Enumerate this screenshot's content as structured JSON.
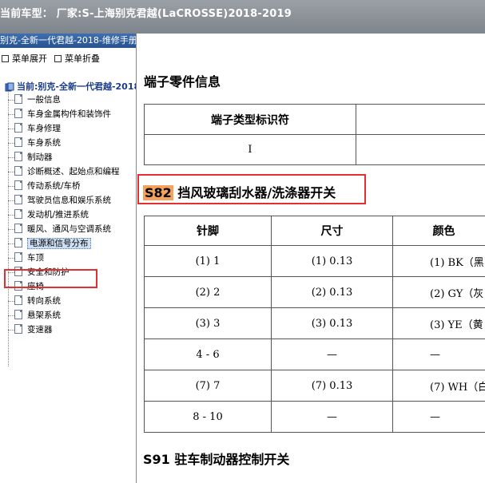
{
  "window": {
    "title": "当前车型：  厂家:S-上海别克君越(LaCROSSE)2018-2019"
  },
  "sidebar": {
    "book_title": "别克-全新一代君越-2018-维修手册",
    "expand_label": "菜单展开",
    "collapse_label": "菜单折叠",
    "root_label": "当前:别克-全新一代君越-2018",
    "items": [
      {
        "label": "一般信息"
      },
      {
        "label": "车身金属构件和装饰件"
      },
      {
        "label": "车身修理"
      },
      {
        "label": "车身系统"
      },
      {
        "label": "制动器"
      },
      {
        "label": "诊断概述、起始点和编程"
      },
      {
        "label": "传动系统/车桥"
      },
      {
        "label": "驾驶员信息和娱乐系统"
      },
      {
        "label": "发动机/推进系统"
      },
      {
        "label": "暖风、通风与空调系统"
      },
      {
        "label": "电源和信号分布"
      },
      {
        "label": "车顶"
      },
      {
        "label": "安全和防护"
      },
      {
        "label": "座椅"
      },
      {
        "label": "转向系统"
      },
      {
        "label": "悬架系统"
      },
      {
        "label": "变速器"
      }
    ],
    "selected_index": 10
  },
  "main": {
    "terminal_heading": "端子零件信息",
    "terminal_table": {
      "header": "端子类型标识符",
      "value": "I"
    },
    "s82": {
      "code": "S82",
      "title": "挡风玻璃刮水器/洗涤器开关"
    },
    "pin_table": {
      "headers": [
        "针脚",
        "尺寸",
        "颜色"
      ],
      "rows": [
        [
          "(1) 1",
          "(1) 0.13",
          "(1) BK（黑"
        ],
        [
          "(2) 2",
          "(2) 0.13",
          "(2) GY（灰"
        ],
        [
          "(3) 3",
          "(3) 0.13",
          "(3) YE（黄"
        ],
        [
          "4 - 6",
          "—",
          "—"
        ],
        [
          "(7) 7",
          "(7) 0.13",
          "(7) WH（白"
        ],
        [
          "8 - 10",
          "—",
          "—"
        ]
      ]
    },
    "s91": {
      "code": "S91",
      "title": "驻车制动器控制开关"
    }
  }
}
